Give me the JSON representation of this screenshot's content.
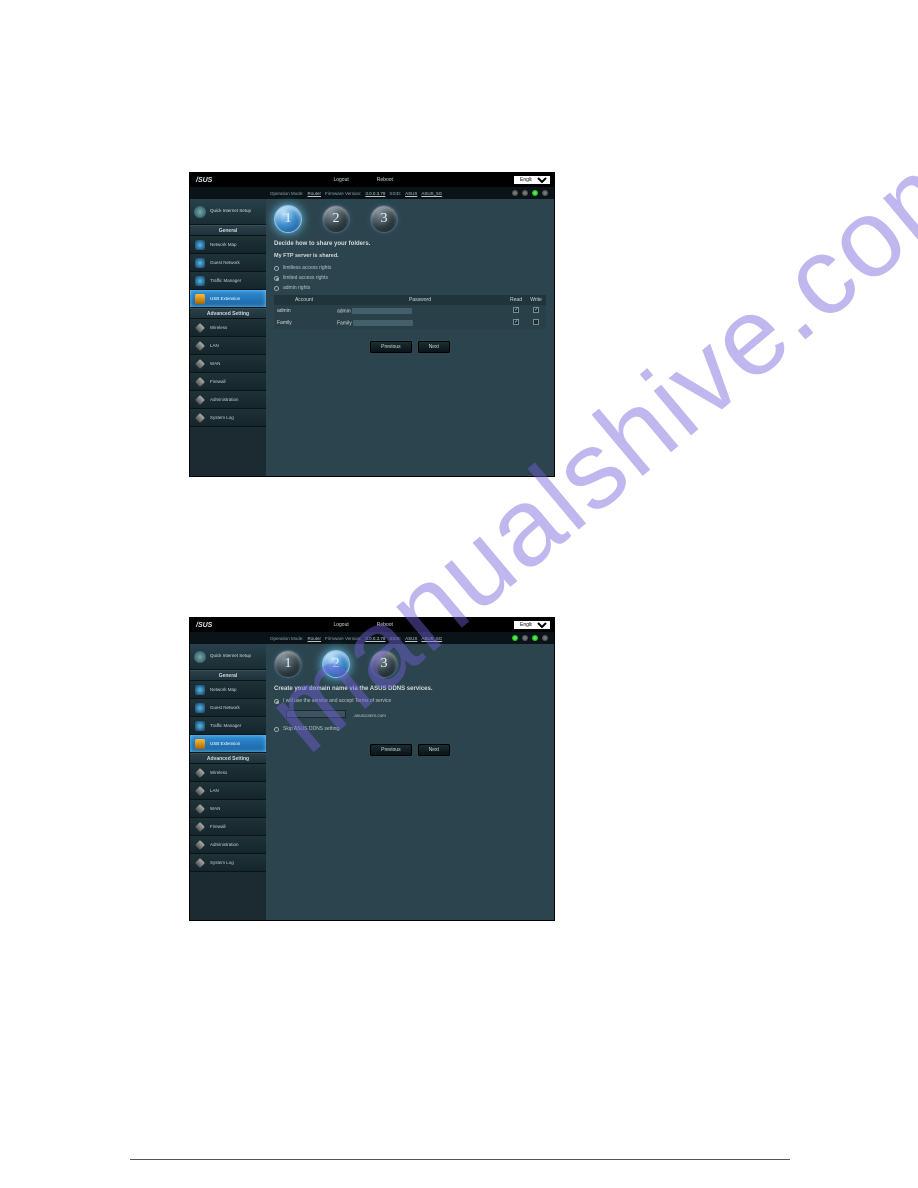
{
  "watermark": "manualshive.com",
  "topbar": {
    "brand": "/SUS",
    "logout": "Logout",
    "reboot": "Reboot",
    "language": "English"
  },
  "infobar": {
    "opmode_k": "Operation Mode:",
    "opmode_v": "Router",
    "fw_k": "Firmware Version:",
    "fw_v": "3.0.0.3.78",
    "ssid_k": "SSID:",
    "ssid1": "ASUS",
    "ssid2": "ASUS_5G"
  },
  "sidebar": {
    "qis": "Quick Internet Setup",
    "general": "General",
    "advanced": "Advanced Setting",
    "items": [
      {
        "label": "Network Map"
      },
      {
        "label": "Guest Network"
      },
      {
        "label": "Traffic Manager"
      },
      {
        "label": "USB Extension"
      },
      {
        "label": "Wireless"
      },
      {
        "label": "LAN"
      },
      {
        "label": "WAN"
      },
      {
        "label": "Firewall"
      },
      {
        "label": "Administration"
      },
      {
        "label": "System Log"
      }
    ]
  },
  "steps": {
    "s1": "1",
    "s2": "2",
    "s3": "3"
  },
  "screen1": {
    "heading": "Decide how to share your folders.",
    "sub": "My FTP server is shared.",
    "opt1": "limitless access rights",
    "opt2": "limited access rights",
    "opt3": "admin rights",
    "th_account": "Account",
    "th_password": "Password",
    "th_read": "Read",
    "th_write": "Write",
    "row1_acc": "admin",
    "row1_pw": "admin",
    "row2_acc": "Family",
    "row2_pw": "Family",
    "prev": "Previous",
    "next": "Next"
  },
  "screen2": {
    "heading": "Create your domain name via the ASUS DDNS services.",
    "opt1": "I will use the service and accept Terms of service",
    "suffix": ".asuscomm.com",
    "opt2": "Skip ASUS DDNS setting.",
    "prev": "Previous",
    "next": "Next"
  }
}
